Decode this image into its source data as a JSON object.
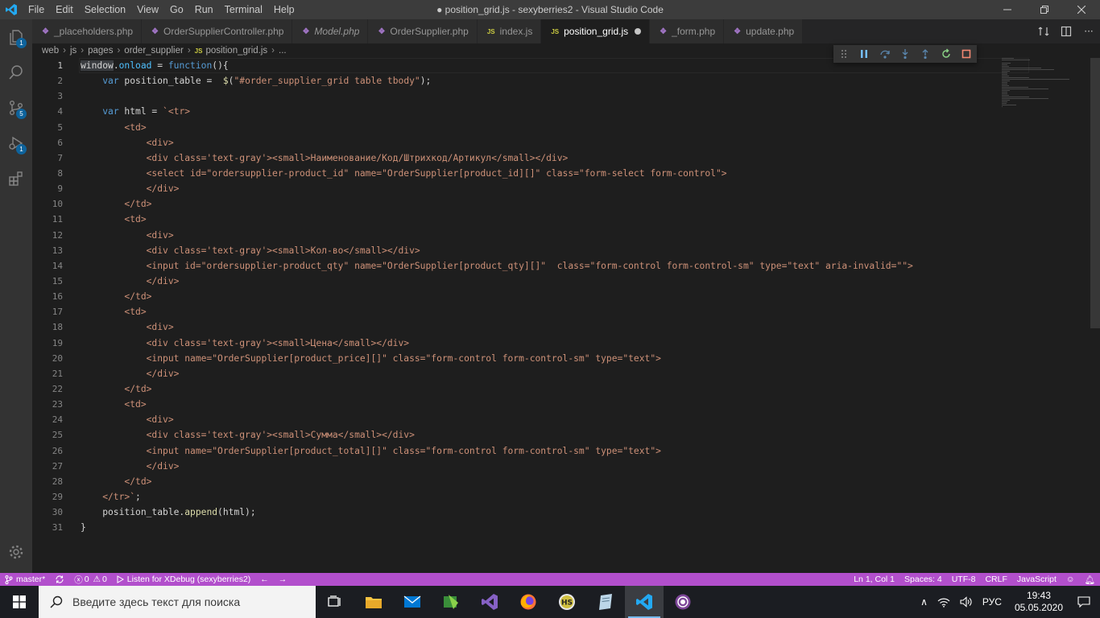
{
  "titlebar": {
    "menu": [
      "File",
      "Edit",
      "Selection",
      "View",
      "Go",
      "Run",
      "Terminal",
      "Help"
    ],
    "title": "● position_grid.js - sexyberries2 - Visual Studio Code"
  },
  "activity_badges": {
    "explorer": "1",
    "scm": "5",
    "debug": "1"
  },
  "tabs": [
    {
      "label": "_placeholders.php",
      "type": "php",
      "italic": false
    },
    {
      "label": "OrderSupplierController.php",
      "type": "php",
      "italic": false
    },
    {
      "label": "Model.php",
      "type": "php",
      "italic": true
    },
    {
      "label": "OrderSupplier.php",
      "type": "php",
      "italic": false
    },
    {
      "label": "index.js",
      "type": "js",
      "italic": false
    },
    {
      "label": "position_grid.js",
      "type": "js",
      "italic": false,
      "active": true,
      "dirty": true
    },
    {
      "label": "_form.php",
      "type": "php",
      "italic": false
    },
    {
      "label": "update.php",
      "type": "php",
      "italic": false
    }
  ],
  "breadcrumb": [
    "web",
    "js",
    "pages",
    "order_supplier",
    "position_grid.js",
    "..."
  ],
  "code": {
    "current_line": 1,
    "lines": [
      [
        [
          "sel",
          "window"
        ],
        [
          "plain",
          "."
        ],
        [
          "prop",
          "onload"
        ],
        [
          "plain",
          " = "
        ],
        [
          "kw",
          "function"
        ],
        [
          "plain",
          "(){"
        ]
      ],
      [
        [
          "plain",
          "    "
        ],
        [
          "kw",
          "var"
        ],
        [
          "plain",
          " position_table =  "
        ],
        [
          "fn",
          "$"
        ],
        [
          "plain",
          "("
        ],
        [
          "str",
          "\"#order_supplier_grid table tbody\""
        ],
        [
          "plain",
          ");"
        ]
      ],
      [],
      [
        [
          "plain",
          "    "
        ],
        [
          "kw",
          "var"
        ],
        [
          "plain",
          " html = "
        ],
        [
          "tmpl",
          "`<tr>"
        ]
      ],
      [
        [
          "tmpl",
          "        <td>"
        ]
      ],
      [
        [
          "tmpl",
          "            <div>"
        ]
      ],
      [
        [
          "tmpl",
          "            <div class='text-gray'><small>Наименование/Код/Штрихкод/Артикул</small></div>"
        ]
      ],
      [
        [
          "tmpl",
          "            <select id=\"ordersupplier-product_id\" name=\"OrderSupplier[product_id][]\" class=\"form-select form-control\">"
        ]
      ],
      [
        [
          "tmpl",
          "            </div>"
        ]
      ],
      [
        [
          "tmpl",
          "        </td>"
        ]
      ],
      [
        [
          "tmpl",
          "        <td>"
        ]
      ],
      [
        [
          "tmpl",
          "            <div>"
        ]
      ],
      [
        [
          "tmpl",
          "            <div class='text-gray'><small>Кол-во</small></div>"
        ]
      ],
      [
        [
          "tmpl",
          "            <input id=\"ordersupplier-product_qty\" name=\"OrderSupplier[product_qty][]\"  class=\"form-control form-control-sm\" type=\"text\" aria-invalid=\"\">"
        ]
      ],
      [
        [
          "tmpl",
          "            </div>"
        ]
      ],
      [
        [
          "tmpl",
          "        </td>"
        ]
      ],
      [
        [
          "tmpl",
          "        <td>"
        ]
      ],
      [
        [
          "tmpl",
          "            <div>"
        ]
      ],
      [
        [
          "tmpl",
          "            <div class='text-gray'><small>Цена</small></div>"
        ]
      ],
      [
        [
          "tmpl",
          "            <input name=\"OrderSupplier[product_price][]\" class=\"form-control form-control-sm\" type=\"text\">"
        ]
      ],
      [
        [
          "tmpl",
          "            </div>"
        ]
      ],
      [
        [
          "tmpl",
          "        </td>"
        ]
      ],
      [
        [
          "tmpl",
          "        <td>"
        ]
      ],
      [
        [
          "tmpl",
          "            <div>"
        ]
      ],
      [
        [
          "tmpl",
          "            <div class='text-gray'><small>Сумма</small></div>"
        ]
      ],
      [
        [
          "tmpl",
          "            <input name=\"OrderSupplier[product_total][]\" class=\"form-control form-control-sm\" type=\"text\">"
        ]
      ],
      [
        [
          "tmpl",
          "            </div>"
        ]
      ],
      [
        [
          "tmpl",
          "        </td>"
        ]
      ],
      [
        [
          "tmpl",
          "    </tr>`"
        ],
        [
          "plain",
          ";"
        ]
      ],
      [
        [
          "plain",
          "    position_table."
        ],
        [
          "fn",
          "append"
        ],
        [
          "plain",
          "(html);"
        ]
      ],
      [
        [
          "plain",
          "}"
        ]
      ]
    ]
  },
  "statusbar": {
    "branch": "master*",
    "errors": "0",
    "warnings": "0",
    "debug": "Listen for XDebug (sexyberries2)",
    "position": "Ln 1, Col 1",
    "spaces": "Spaces: 4",
    "encoding": "UTF-8",
    "eol": "CRLF",
    "language": "JavaScript"
  },
  "taskbar": {
    "search_placeholder": "Введите здесь текст для поиска",
    "language": "РУС",
    "time": "19:43",
    "date": "05.05.2020"
  },
  "colors": {
    "statusbar": "#b24fcc",
    "editor_bg": "#1e1e1e",
    "keyword": "#569cd6",
    "string": "#ce9178"
  }
}
